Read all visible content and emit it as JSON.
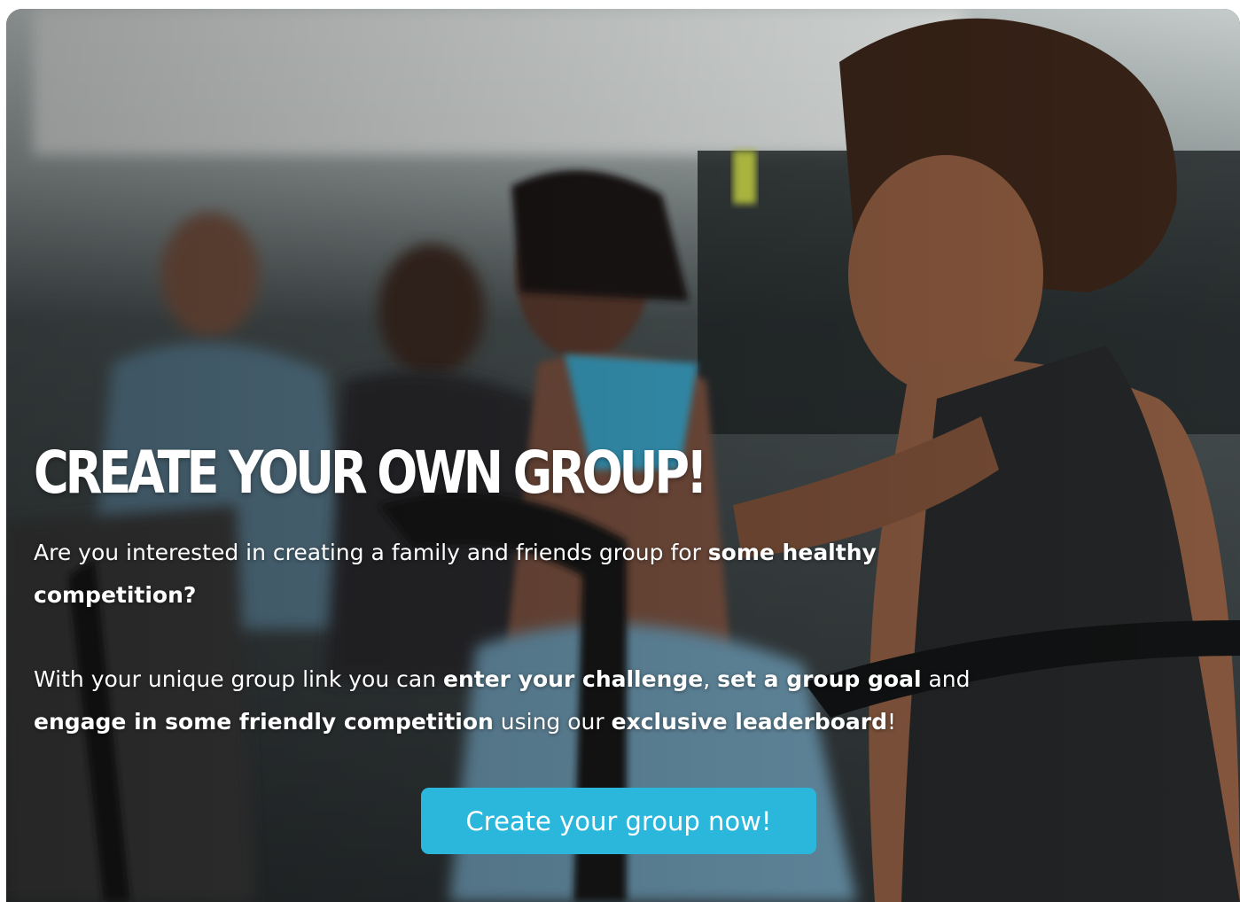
{
  "hero": {
    "image_name": "group-cycling-class-photo",
    "title": "CREATE YOUR OWN GROUP!",
    "paragraph1": {
      "lead": "Are you interested in creating a family and friends group for ",
      "emph": "some healthy competition?"
    },
    "paragraph2": {
      "t1": "With your unique group link you can ",
      "b1": "enter your challenge",
      "t2": ", ",
      "b2": "set a group goal",
      "t3": " and ",
      "b3": "engage in some friendly competition",
      "t4": " using our ",
      "b4": "exclusive leaderboard",
      "t5": "!"
    },
    "cta_label": "Create your group now!"
  },
  "colors": {
    "cta_background": "#2bb7dc",
    "text": "#ffffff"
  }
}
